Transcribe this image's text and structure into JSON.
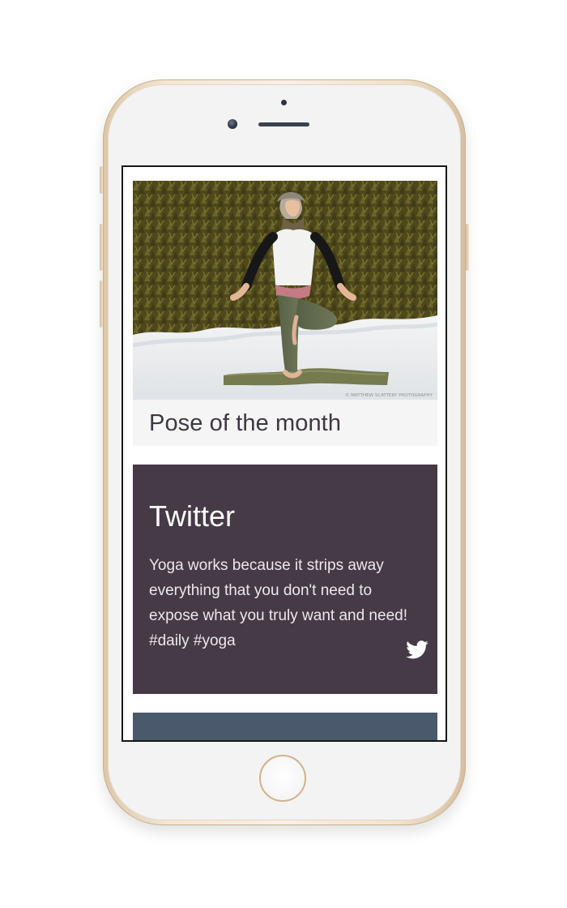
{
  "screen": {
    "pose_card": {
      "title": "Pose of the month",
      "image_alt": "yoga-pose-photo",
      "photo_credit": "© MATTHEW SCATTERY PHOTOGRAPHY"
    },
    "twitter_card": {
      "title": "Twitter",
      "tweet": "Yoga works because it strips away everything that you don't need to expose what you truly want and need! #daily #yoga",
      "icon": "twitter-icon"
    }
  },
  "colors": {
    "twitter_card_bg": "#463a46",
    "bottom_card_bg": "#4a596b",
    "pose_card_bg": "#f5f5f5",
    "title_text": "#3f3742"
  }
}
